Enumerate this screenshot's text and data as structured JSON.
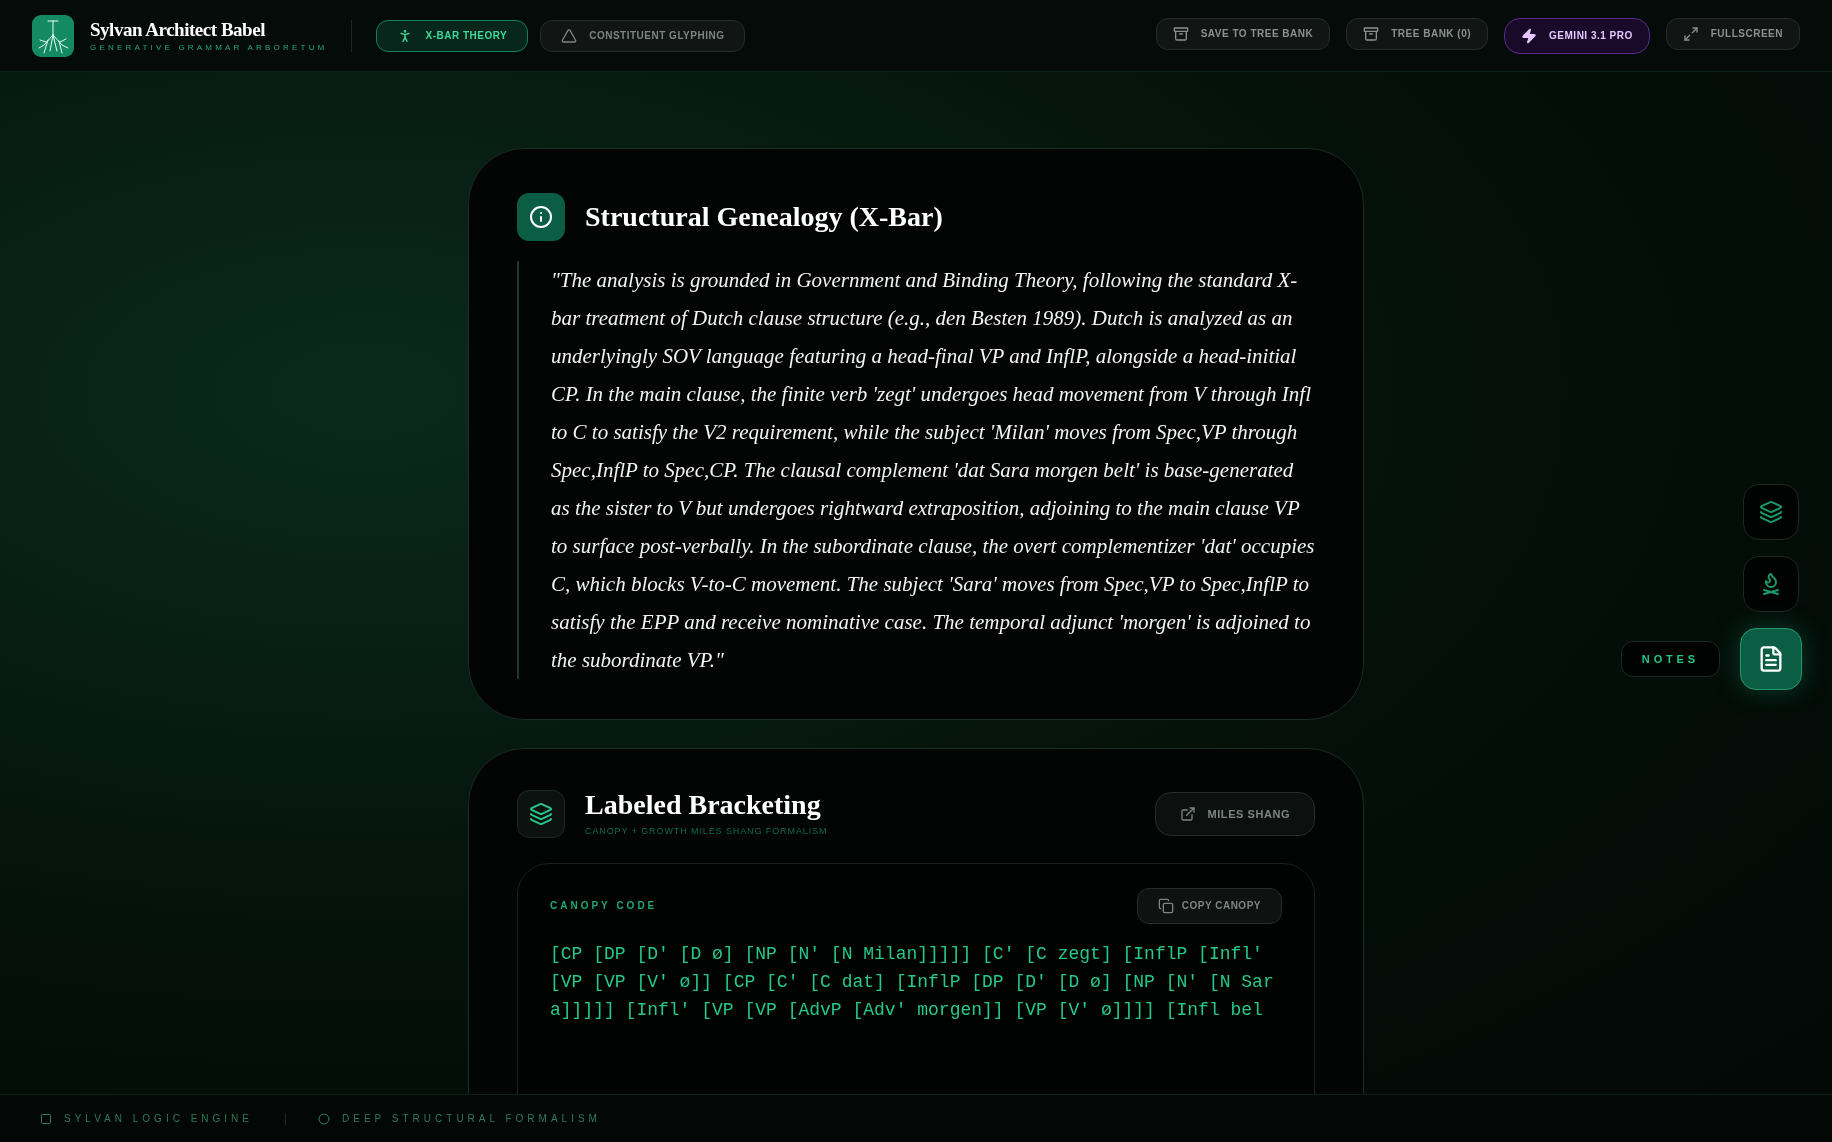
{
  "header": {
    "title": "Sylvan Architect Babel",
    "subtitle": "GENERATIVE GRAMMAR ARBORETUM",
    "mode_tabs": [
      {
        "label": "X-BAR THEORY",
        "selected": true,
        "kind": "xbar"
      },
      {
        "label": "CONSTITUENT GLYPHING",
        "selected": false,
        "kind": "triangle"
      }
    ],
    "actions": [
      {
        "label": "SAVE TO TREE BANK",
        "kind": "archive"
      },
      {
        "label": "TREE BANK (0)",
        "kind": "archive"
      },
      {
        "label": "GEMINI 3.1 PRO",
        "kind": "model"
      },
      {
        "label": "FULLSCREEN",
        "kind": "fullscreen"
      }
    ]
  },
  "genealogy": {
    "title": "Structural Genealogy (X-Bar)",
    "quote": "\"The analysis is grounded in Government and Binding Theory, following the standard X-bar treatment of Dutch clause structure (e.g., den Besten 1989). Dutch is analyzed as an underlyingly SOV language featuring a head-final VP and InflP, alongside a head-initial CP. In the main clause, the finite verb 'zegt' undergoes head movement from V through Infl to C to satisfy the V2 requirement, while the subject 'Milan' moves from Spec,VP through Spec,InflP to Spec,CP. The clausal complement 'dat Sara morgen belt' is base-generated as the sister to V but undergoes rightward extraposition, adjoining to the main clause VP to surface post-verbally. In the subordinate clause, the overt complementizer 'dat' occupies C, which blocks V-to-C movement. The subject 'Sara' moves from Spec,VP to Spec,InflP to satisfy the EPP and receive nominative case. The temporal adjunct 'morgen' is adjoined to the subordinate VP.\""
  },
  "bracketing": {
    "title": "Labeled Bracketing",
    "subtitle": "CANOPY + GROWTH MILES SHANG FORMALISM",
    "link_button": "MILES SHANG",
    "canopy": {
      "label": "CANOPY CODE",
      "copy_button": "COPY CANOPY",
      "code_lines": [
        "[CP [DP [D' [D ø] [NP [N' [N Milan]]]]] [C' [C zegt] [InflP [Infl'",
        "[VP [VP [V' ø]] [CP [C' [C dat] [InflP [DP [D' [D ø] [NP [N' [N Sar",
        "a]]]]] [Infl' [VP [VP [AdvP [Adv' morgen]] [VP [V' ø]]]] [Infl bel"
      ]
    }
  },
  "side_rail": {
    "tooltip": "NOTES",
    "items": [
      {
        "kind": "layers",
        "selected": false
      },
      {
        "kind": "fire",
        "selected": false
      },
      {
        "kind": "notes",
        "selected": true
      }
    ]
  },
  "footer": {
    "items": [
      {
        "label": "SYLVAN LOGIC ENGINE",
        "kind": "square"
      },
      {
        "label": "DEEP STRUCTURAL FORMALISM",
        "kind": "circle"
      }
    ]
  }
}
